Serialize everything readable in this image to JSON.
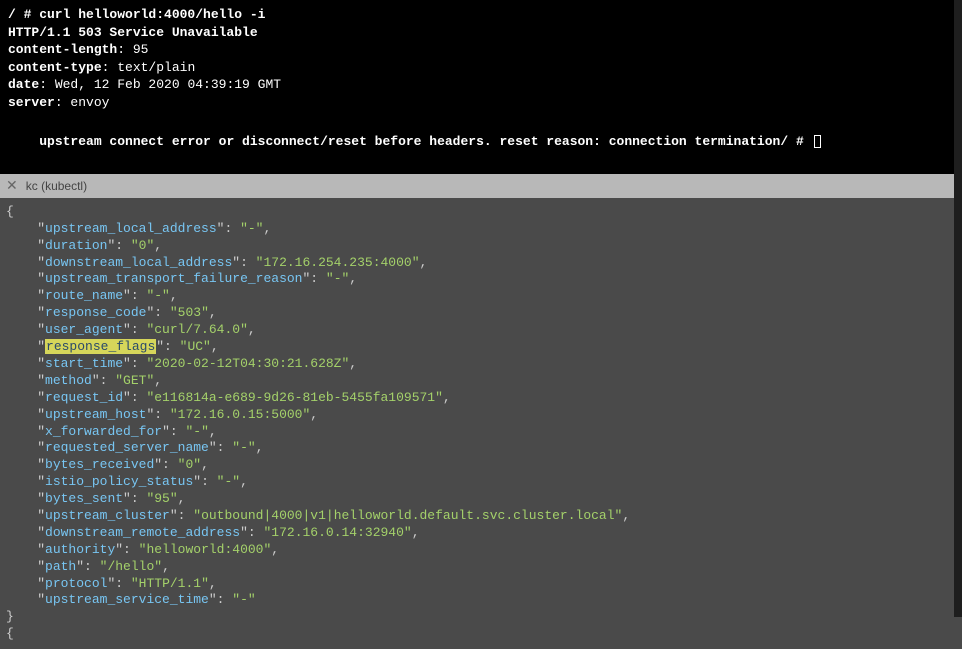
{
  "top": {
    "cmd": "/ # curl helloworld:4000/hello -i",
    "status": "HTTP/1.1 503 Service Unavailable",
    "headers": [
      {
        "k": "content-length",
        "v": ": 95"
      },
      {
        "k": "content-type",
        "v": ": text/plain"
      },
      {
        "k": "date",
        "v": ": Wed, 12 Feb 2020 04:39:19 GMT"
      },
      {
        "k": "server",
        "v": ": envoy"
      }
    ],
    "error": "upstream connect error or disconnect/reset before headers. reset reason: connection termination/ # "
  },
  "tab": {
    "close": "✕",
    "title": "kc (kubectl)"
  },
  "json": {
    "open": "{",
    "close": "}",
    "indent": "    ",
    "highlighted_key": "response_flags",
    "entries": [
      {
        "key": "upstream_local_address",
        "value": "-"
      },
      {
        "key": "duration",
        "value": "0"
      },
      {
        "key": "downstream_local_address",
        "value": "172.16.254.235:4000"
      },
      {
        "key": "upstream_transport_failure_reason",
        "value": "-"
      },
      {
        "key": "route_name",
        "value": "-"
      },
      {
        "key": "response_code",
        "value": "503"
      },
      {
        "key": "user_agent",
        "value": "curl/7.64.0"
      },
      {
        "key": "response_flags",
        "value": "UC"
      },
      {
        "key": "start_time",
        "value": "2020-02-12T04:30:21.628Z"
      },
      {
        "key": "method",
        "value": "GET"
      },
      {
        "key": "request_id",
        "value": "e116814a-e689-9d26-81eb-5455fa109571"
      },
      {
        "key": "upstream_host",
        "value": "172.16.0.15:5000"
      },
      {
        "key": "x_forwarded_for",
        "value": "-"
      },
      {
        "key": "requested_server_name",
        "value": "-"
      },
      {
        "key": "bytes_received",
        "value": "0"
      },
      {
        "key": "istio_policy_status",
        "value": "-"
      },
      {
        "key": "bytes_sent",
        "value": "95"
      },
      {
        "key": "upstream_cluster",
        "value": "outbound|4000|v1|helloworld.default.svc.cluster.local"
      },
      {
        "key": "downstream_remote_address",
        "value": "172.16.0.14:32940"
      },
      {
        "key": "authority",
        "value": "helloworld:4000"
      },
      {
        "key": "path",
        "value": "/hello"
      },
      {
        "key": "protocol",
        "value": "HTTP/1.1"
      },
      {
        "key": "upstream_service_time",
        "value": "-"
      }
    ],
    "last_brace": "{"
  }
}
